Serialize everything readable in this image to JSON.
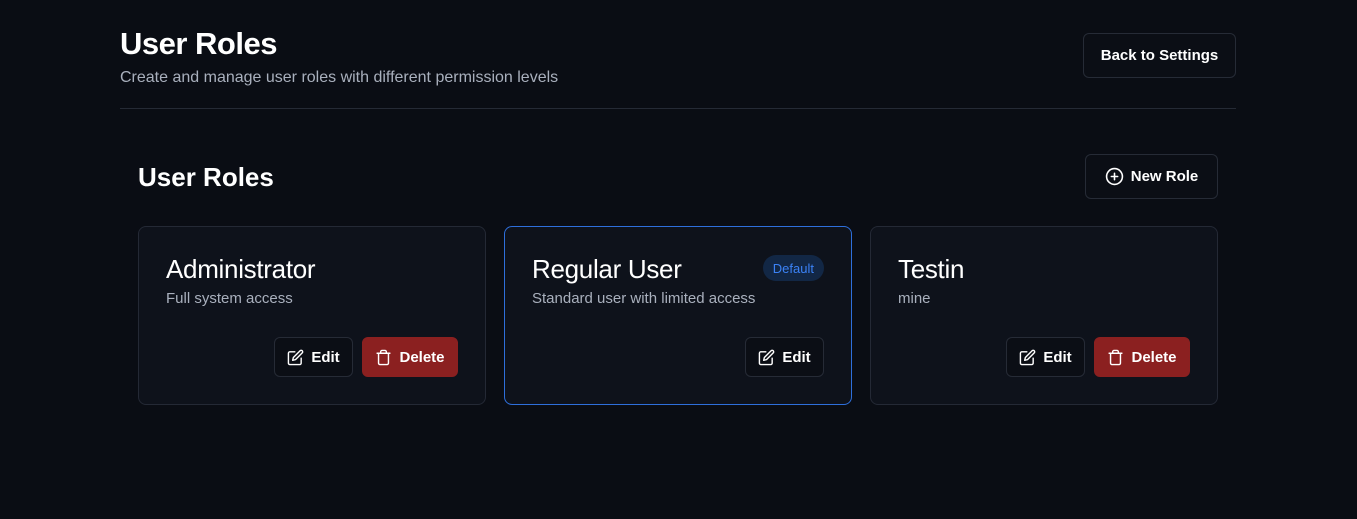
{
  "header": {
    "title": "User Roles",
    "subtitle": "Create and manage user roles with different permission levels",
    "back_label": "Back to Settings"
  },
  "section": {
    "title": "User Roles",
    "new_role_label": "New Role",
    "new_role_icon": "plus-circle-icon"
  },
  "colors": {
    "background": "#0a0d14",
    "card": "#0e121b",
    "default_border": "#2e6fdb",
    "delete": "#8b2020",
    "badge_text": "#3b82f6"
  },
  "roles": [
    {
      "name": "Administrator",
      "description": "Full system access",
      "default": false,
      "edit_label": "Edit",
      "delete_label": "Delete"
    },
    {
      "name": "Regular User",
      "description": "Standard user with limited access",
      "default": true,
      "badge": "Default",
      "edit_label": "Edit"
    },
    {
      "name": "Testin",
      "description": "mine",
      "default": false,
      "edit_label": "Edit",
      "delete_label": "Delete"
    }
  ]
}
